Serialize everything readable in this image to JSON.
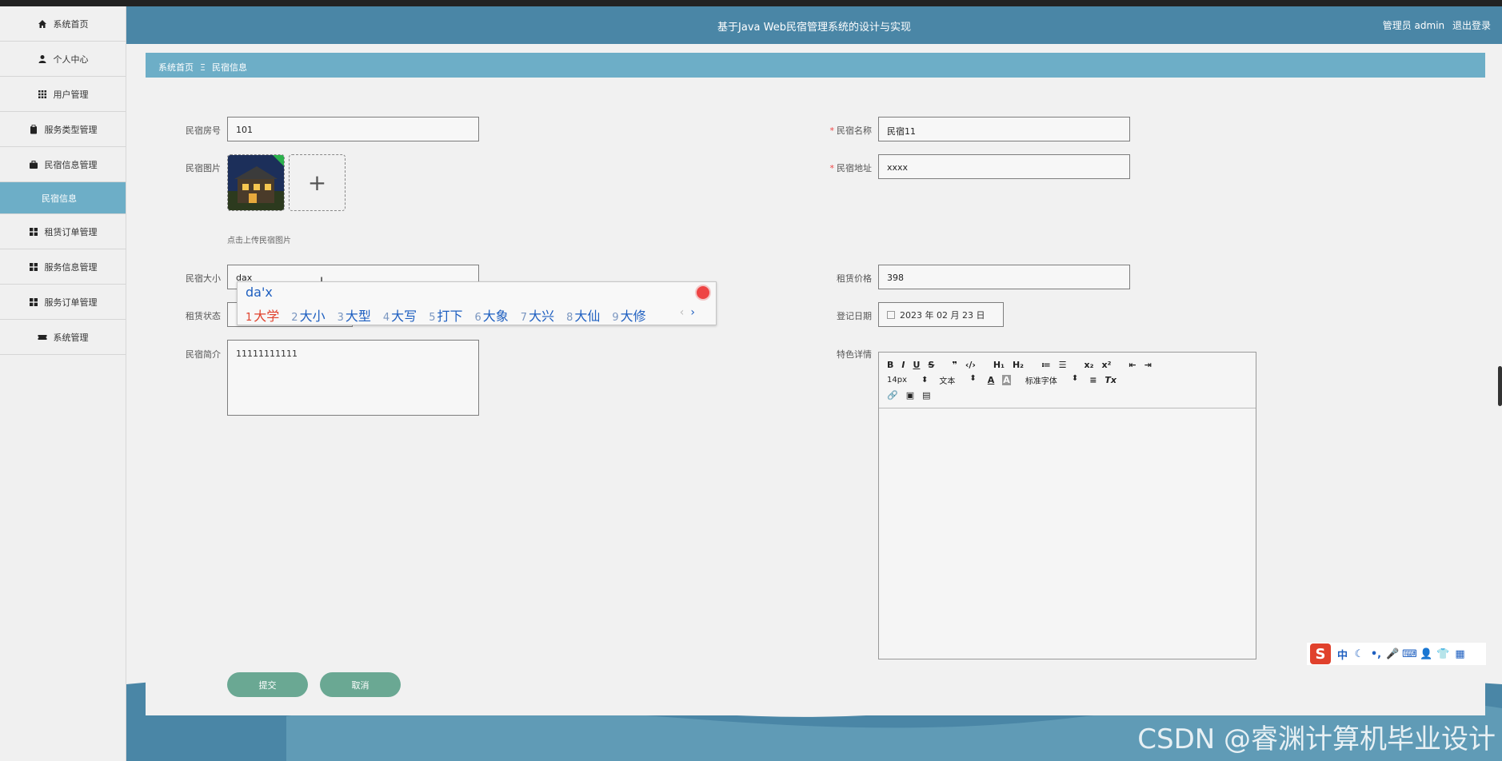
{
  "header": {
    "title": "基于Java Web民宿管理系统的设计与实现",
    "user_label": "管理员 admin",
    "logout": "退出登录"
  },
  "sidebar": {
    "items": [
      {
        "label": "系统首页",
        "icon": "home-icon"
      },
      {
        "label": "个人中心",
        "icon": "person-icon"
      },
      {
        "label": "用户管理",
        "icon": "grid-icon"
      },
      {
        "label": "服务类型管理",
        "icon": "clipboard-icon"
      },
      {
        "label": "民宿信息管理",
        "icon": "briefcase-icon"
      },
      {
        "label": "民宿信息",
        "icon": "",
        "active": true
      },
      {
        "label": "租赁订单管理",
        "icon": "apps-icon"
      },
      {
        "label": "服务信息管理",
        "icon": "apps-icon"
      },
      {
        "label": "服务订单管理",
        "icon": "apps-icon"
      },
      {
        "label": "系统管理",
        "icon": "ticket-icon"
      }
    ]
  },
  "breadcrumb": {
    "home": "系统首页",
    "sep": "Ξ",
    "current": "民宿信息"
  },
  "form": {
    "room_no": {
      "label": "民宿房号",
      "value": "101"
    },
    "name": {
      "label": "民宿名称",
      "value": "民宿11",
      "required": "*"
    },
    "image": {
      "label": "民宿图片",
      "hint": "点击上传民宿图片",
      "add": "+"
    },
    "address": {
      "label": "民宿地址",
      "value": "xxxx",
      "required": "*"
    },
    "size": {
      "label": "民宿大小",
      "value": "dax"
    },
    "price": {
      "label": "租赁价格",
      "value": "398"
    },
    "status": {
      "label": "租赁状态"
    },
    "date": {
      "label": "登记日期",
      "value": "2023 年 02 月 23 日"
    },
    "intro": {
      "label": "民宿简介",
      "value": "11111111111"
    },
    "detail": {
      "label": "特色详情"
    }
  },
  "editor": {
    "row1": [
      "B",
      "I",
      "U",
      "S",
      "❞",
      "‹/›",
      "H₁",
      "H₂",
      "≔",
      "☰",
      "x₂",
      "x²",
      "⇤",
      "⇥"
    ],
    "size_select": "14px",
    "style_select": "文本",
    "font_select": "标准字体",
    "row2_tail": [
      "A",
      "A",
      "≡",
      "Tx"
    ],
    "row3": [
      "link-icon",
      "image-icon",
      "video-icon"
    ]
  },
  "buttons": {
    "submit": "提交",
    "cancel": "取消"
  },
  "ime": {
    "composition": "da'x",
    "candidates": [
      {
        "n": "1",
        "w": "大学"
      },
      {
        "n": "2",
        "w": "大小"
      },
      {
        "n": "3",
        "w": "大型"
      },
      {
        "n": "4",
        "w": "大写"
      },
      {
        "n": "5",
        "w": "打下"
      },
      {
        "n": "6",
        "w": "大象"
      },
      {
        "n": "7",
        "w": "大兴"
      },
      {
        "n": "8",
        "w": "大仙"
      },
      {
        "n": "9",
        "w": "大修"
      }
    ],
    "prev": "‹",
    "next": "›",
    "bar": {
      "logo": "S",
      "mode": "中"
    }
  },
  "watermark": "CSDN @睿渊计算机毕业设计",
  "colors": {
    "header": "#4a86a6",
    "breadcrumb": "#6daec7",
    "button": "#6aa893",
    "active": "#6daec7"
  }
}
